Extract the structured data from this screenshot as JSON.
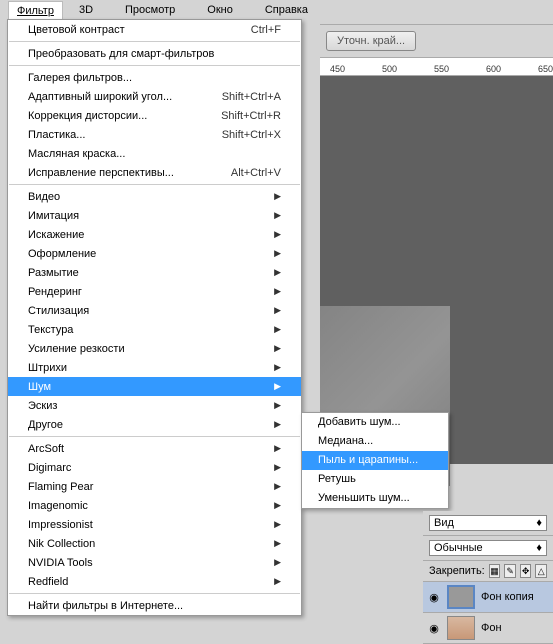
{
  "menubar": {
    "filter": "Фильтр",
    "td": "3D",
    "view": "Просмотр",
    "window": "Окно",
    "help": "Справка"
  },
  "opts": {
    "refine": "Уточн. край..."
  },
  "ruler": {
    "n1": "450",
    "n2": "500",
    "n3": "550",
    "n4": "600",
    "n5": "650"
  },
  "menu": {
    "last": "Цветовой контраст",
    "lastk": "Ctrl+F",
    "smart": "Преобразовать для смарт-фильтров",
    "gallery": "Галерея фильтров...",
    "wide": "Адаптивный широкий угол...",
    "widek": "Shift+Ctrl+A",
    "lens": "Коррекция дисторсии...",
    "lensk": "Shift+Ctrl+R",
    "liq": "Пластика...",
    "liqk": "Shift+Ctrl+X",
    "oil": "Масляная краска...",
    "vp": "Исправление перспективы...",
    "vpk": "Alt+Ctrl+V",
    "video": "Видео",
    "artistic": "Имитация",
    "distort": "Искажение",
    "pixelate": "Оформление",
    "blur": "Размытие",
    "render": "Рендеринг",
    "stylize": "Стилизация",
    "texture": "Текстура",
    "sharpen": "Усиление резкости",
    "brush": "Штрихи",
    "noise": "Шум",
    "sketch": "Эскиз",
    "other": "Другое",
    "arcsoft": "ArcSoft",
    "digimarc": "Digimarc",
    "flaming": "Flaming Pear",
    "imagenomic": "Imagenomic",
    "impress": "Impressionist",
    "nik": "Nik Collection",
    "nvidia": "NVIDIA Tools",
    "redfield": "Redfield",
    "browse": "Найти фильтры в Интернете..."
  },
  "sub": {
    "add": "Добавить шум...",
    "median": "Медиана...",
    "dust": "Пыль и царапины...",
    "retouch": "Ретушь",
    "reduce": "Уменьшить шум..."
  },
  "panel": {
    "view": "Вид",
    "normal": "Обычные",
    "lock": "Закрепить:",
    "l1": "Фон копия",
    "l2": "Фон"
  }
}
